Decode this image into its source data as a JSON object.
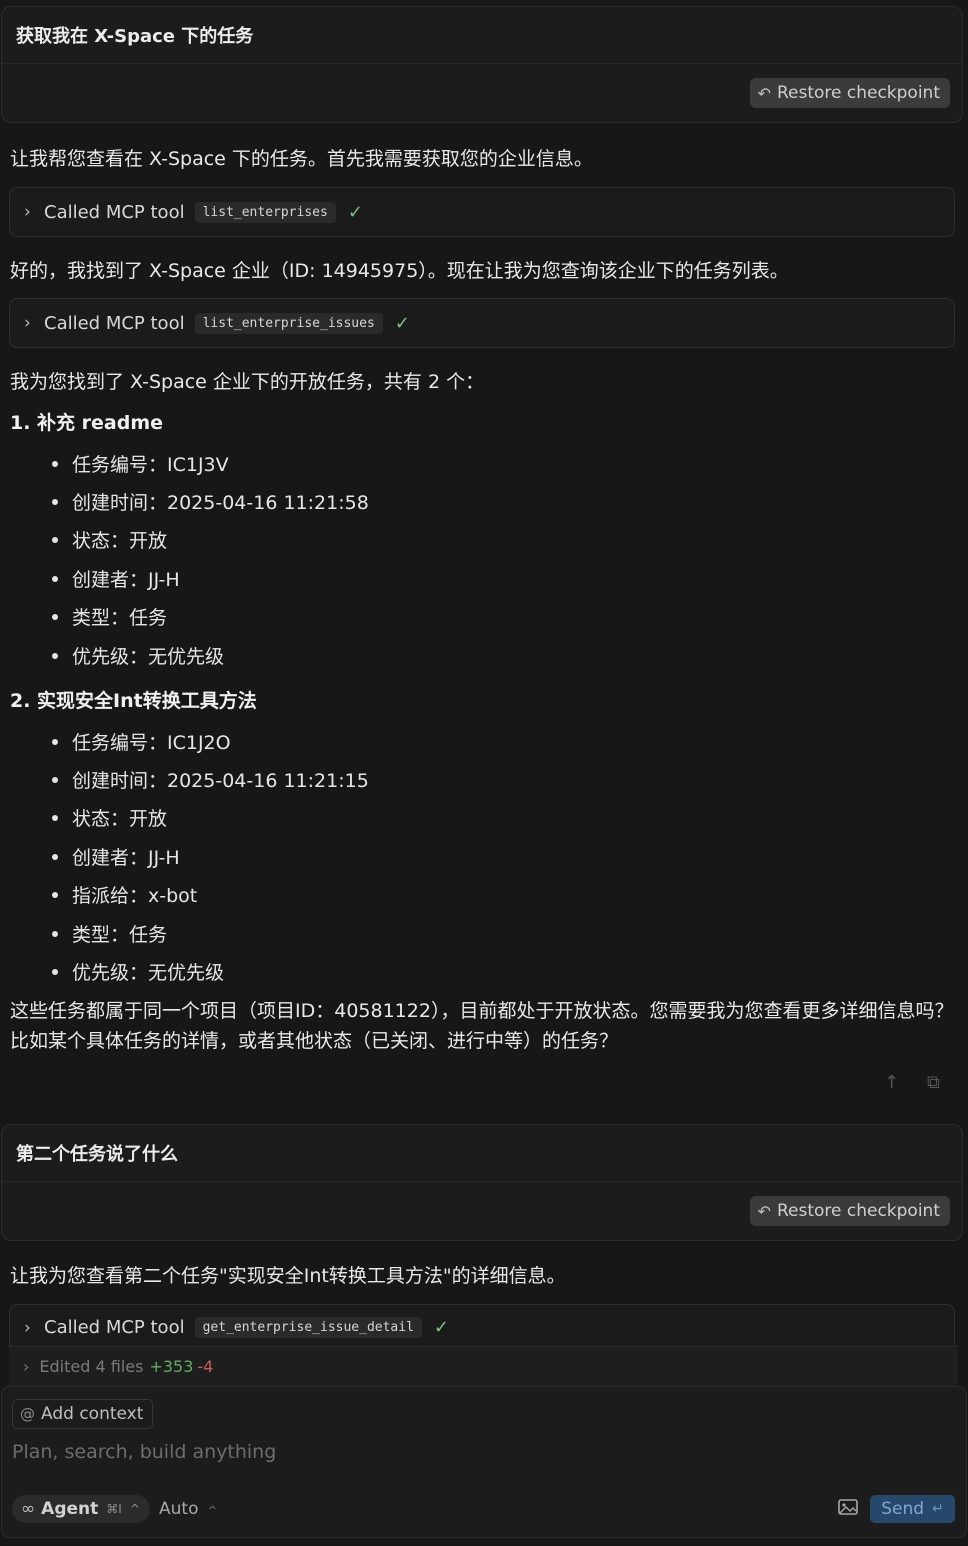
{
  "messages": {
    "user1": {
      "text": "获取我在 X-Space 下的任务",
      "restore_label": "Restore checkpoint"
    },
    "assistant1_intro": "让我帮您查看在 X-Space 下的任务。首先我需要获取您的企业信息。",
    "tool1": {
      "label": "Called MCP tool",
      "name": "list_enterprises"
    },
    "assistant1_found": "好的，我找到了 X-Space 企业（ID: 14945975）。现在让我为您查询该企业下的任务列表。",
    "tool2": {
      "label": "Called MCP tool",
      "name": "list_enterprise_issues"
    },
    "assistant1_summary": "我为您找到了 X-Space 企业下的开放任务，共有 2 个：",
    "task1": {
      "title": "1. 补充 readme",
      "bullets": [
        "任务编号：IC1J3V",
        "创建时间：2025-04-16 11:21:58",
        "状态：开放",
        "创建者：JJ-H",
        "类型：任务",
        "优先级：无优先级"
      ]
    },
    "task2": {
      "title": "2. 实现安全Int转换工具方法",
      "bullets": [
        "任务编号：IC1J2O",
        "创建时间：2025-04-16 11:21:15",
        "状态：开放",
        "创建者：JJ-H",
        "指派给：x-bot",
        "类型：任务",
        "优先级：无优先级"
      ]
    },
    "assistant1_closing": "这些任务都属于同一个项目（项目ID：40581122），目前都处于开放状态。您需要我为您查看更多详细信息吗？比如某个具体任务的详情，或者其他状态（已关闭、进行中等）的任务？",
    "user2": {
      "text": "第二个任务说了什么",
      "restore_label": "Restore checkpoint"
    },
    "assistant2_intro": "让我为您查看第二个任务\"实现安全Int转换工具方法\"的详细信息。",
    "tool3": {
      "label": "Called MCP tool",
      "name": "get_enterprise_issue_detail"
    }
  },
  "edited": {
    "label": "Edited 4 files",
    "plus": "+353",
    "minus": "-4"
  },
  "composer": {
    "add_context": "Add context",
    "placeholder": "Plan, search, build anything",
    "agent_label": "Agent",
    "agent_shortcut": "⌘I",
    "model_label": "Auto",
    "send_label": "Send"
  },
  "icons": {
    "restore": "undo-arrow-icon",
    "chevron": "chevron-right-icon",
    "check": "check-icon",
    "thumb": "arrow-up-icon",
    "copy": "copy-icon",
    "at": "at-sign-icon",
    "infinity": "infinity-icon",
    "image": "image-icon",
    "return": "return-key-icon"
  },
  "colors": {
    "background": "#171717",
    "check": "#7bc47f",
    "added": "#5fae5f",
    "removed": "#c55b5b",
    "send_bg": "#25486b"
  }
}
